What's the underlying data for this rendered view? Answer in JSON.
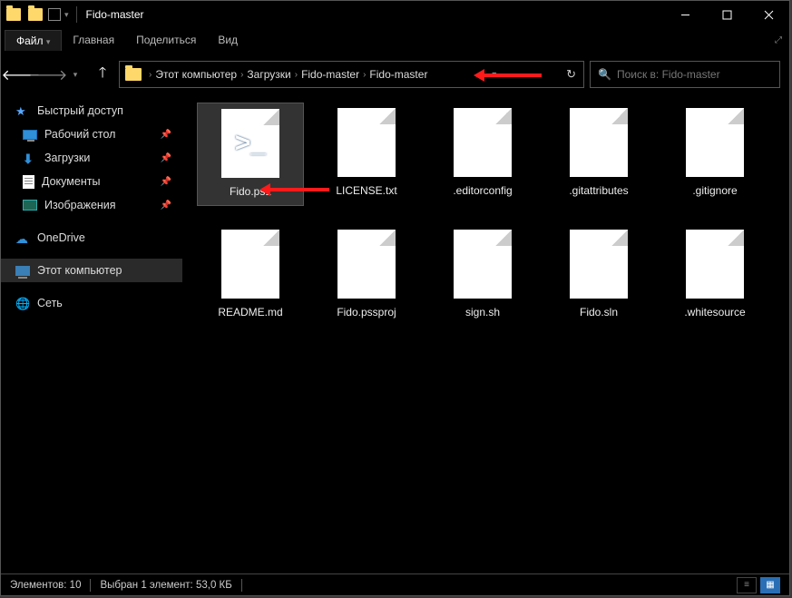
{
  "window": {
    "title": "Fido-master"
  },
  "menu": {
    "file": "Файл",
    "tabs": [
      "Главная",
      "Поделиться",
      "Вид"
    ]
  },
  "breadcrumb": {
    "items": [
      "Этот компьютер",
      "Загрузки",
      "Fido-master",
      "Fido-master"
    ]
  },
  "search": {
    "placeholder": "Поиск в: Fido-master"
  },
  "sidebar": {
    "quick_access": "Быстрый доступ",
    "desktop": "Рабочий стол",
    "downloads": "Загрузки",
    "documents": "Документы",
    "pictures": "Изображения",
    "onedrive": "OneDrive",
    "this_pc": "Этот компьютер",
    "network": "Сеть"
  },
  "files": [
    {
      "name": "Fido.ps1",
      "type": "ps1",
      "selected": true
    },
    {
      "name": "LICENSE.txt",
      "type": "file"
    },
    {
      "name": ".editorconfig",
      "type": "file"
    },
    {
      "name": ".gitattributes",
      "type": "file"
    },
    {
      "name": ".gitignore",
      "type": "file"
    },
    {
      "name": "README.md",
      "type": "file"
    },
    {
      "name": "Fido.pssproj",
      "type": "file"
    },
    {
      "name": "sign.sh",
      "type": "file"
    },
    {
      "name": "Fido.sln",
      "type": "file"
    },
    {
      "name": ".whitesource",
      "type": "file"
    }
  ],
  "status": {
    "count_label": "Элементов: 10",
    "selection_label": "Выбран 1 элемент: 53,0 КБ"
  }
}
